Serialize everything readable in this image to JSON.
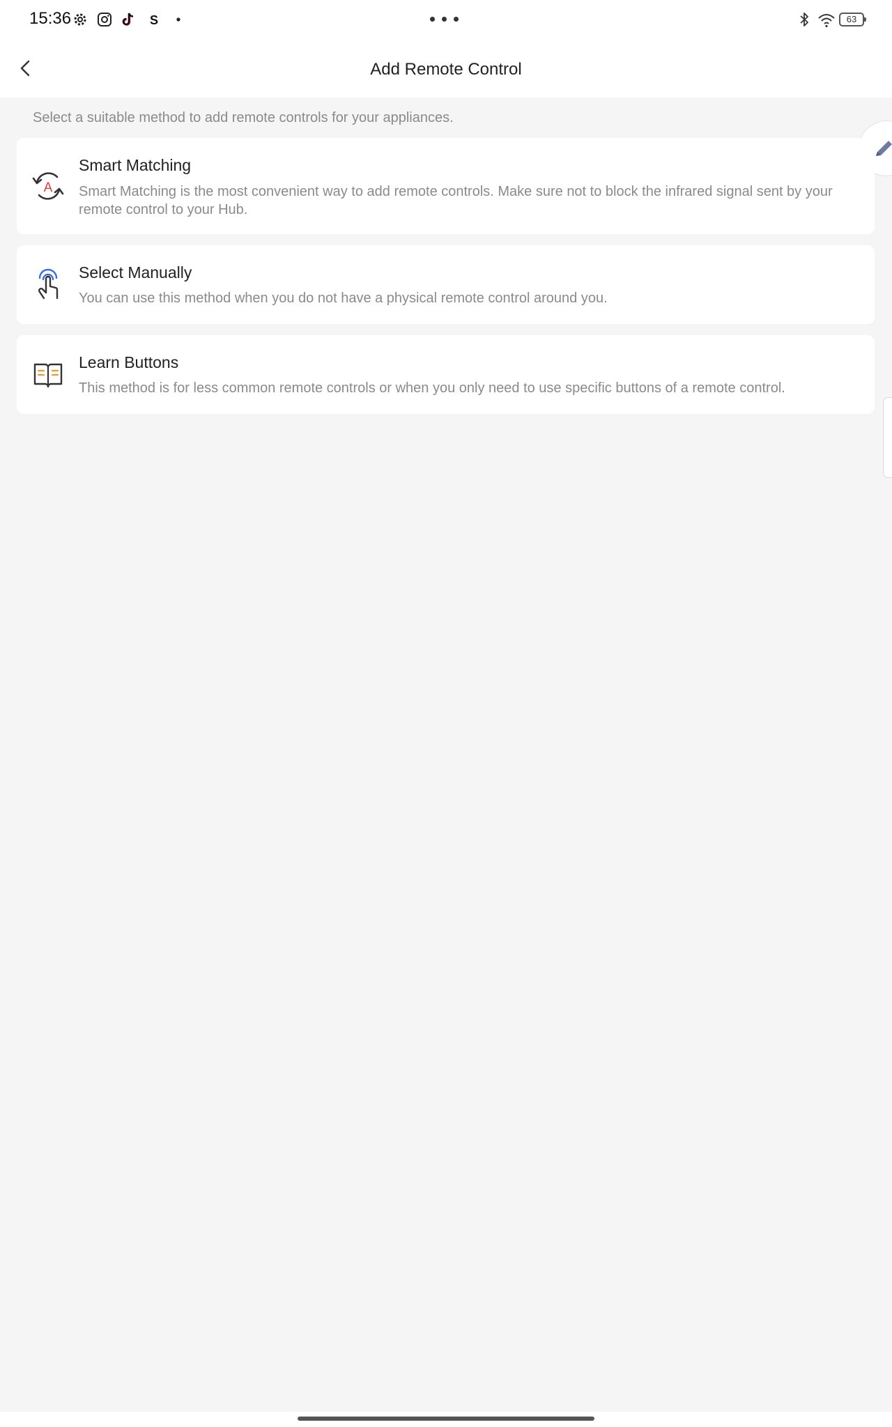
{
  "status_bar": {
    "time": "15:36",
    "icons": [
      "gear-icon",
      "instagram-icon",
      "tiktok-icon",
      "s-app-icon",
      "dot-icon"
    ],
    "battery": "63"
  },
  "header": {
    "title": "Add Remote Control",
    "back_icon": "back-arrow-icon"
  },
  "subtitle": "Select a suitable method to add remote controls for your appliances.",
  "methods": [
    {
      "title": "Smart Matching",
      "description": "Smart Matching is the most convenient way to add remote controls. Make sure not to block the infrared signal sent by your remote control to your Hub.",
      "icon": "smart-matching-icon"
    },
    {
      "title": "Select Manually",
      "description": "You can use this method when you do not have a physical remote control around you.",
      "icon": "tap-hand-icon"
    },
    {
      "title": "Learn Buttons",
      "description": "This method is for less common remote controls or when you only need to use specific buttons of a remote control.",
      "icon": "open-book-icon"
    }
  ],
  "colors": {
    "accent_red": "#e53935",
    "accent_blue": "#3b6fd8",
    "accent_orange": "#f29a2e",
    "edit_fab_icon": "#6d7aa6"
  }
}
